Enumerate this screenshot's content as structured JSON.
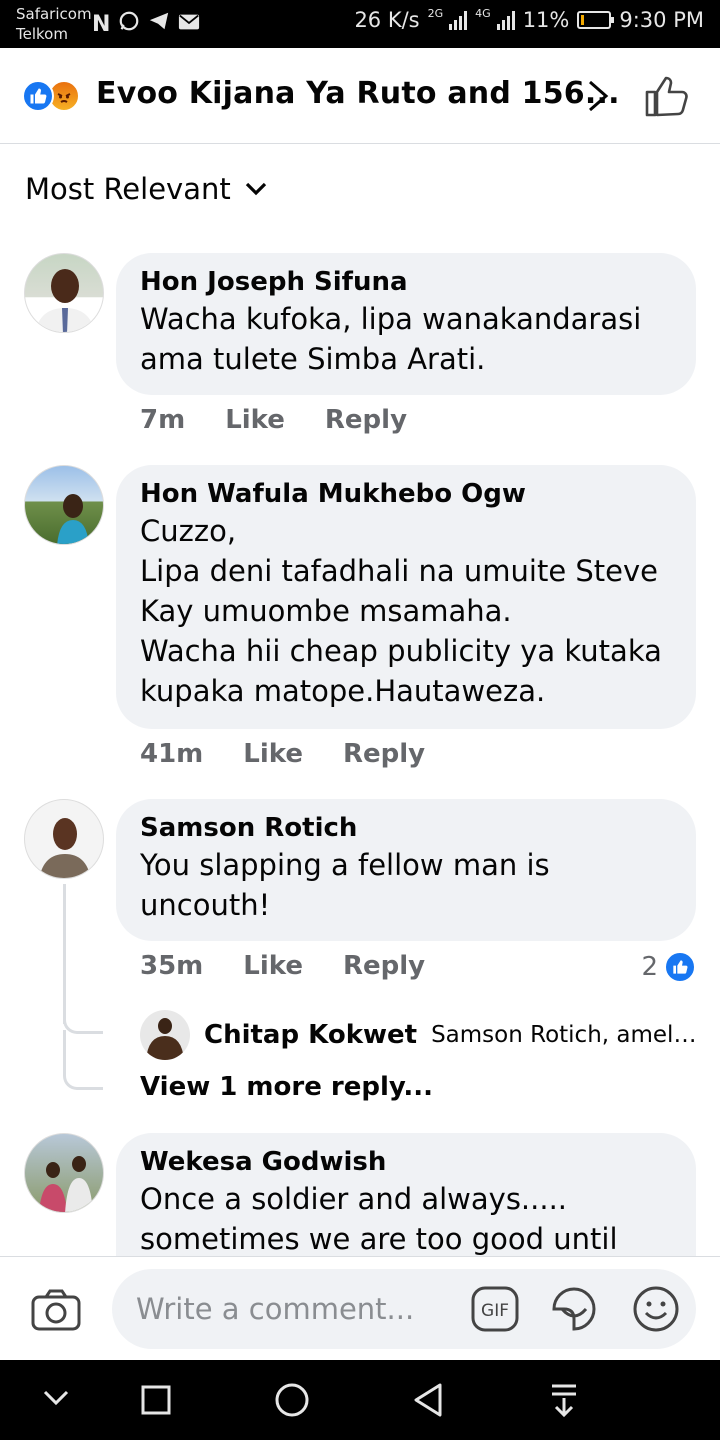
{
  "status_bar": {
    "carrier_1": "Safaricom",
    "carrier_2": "Telkom",
    "speed": "26 K/s",
    "net_1": "2G",
    "net_2": "4G",
    "battery": "11%",
    "battery_level": 0.11,
    "time": "9:30 PM",
    "notification_icons": [
      "n-icon",
      "whatsapp-icon",
      "telegram-icon",
      "mail-icon"
    ]
  },
  "header": {
    "title": "Evoo Kijana Ya Ruto and 156...",
    "reactions": [
      "like-icon",
      "angry-icon"
    ]
  },
  "sort": {
    "label": "Most Relevant"
  },
  "comments": [
    {
      "author": "Hon Joseph Sifuna",
      "text": "Wacha kufoka, lipa wanakandarasi\nama tulete Simba Arati.",
      "time": "7m",
      "like": "Like",
      "reply": "Reply"
    },
    {
      "author": "Hon Wafula Mukhebo Ogw",
      "text": "Cuzzo,\nLipa deni tafadhali na umuite Steve\nKay umuombe msamaha.\nWacha hii cheap publicity ya kutaka\nkupaka matope.Hautaweza.",
      "time": "41m",
      "like": "Like",
      "reply": "Reply"
    },
    {
      "author": "Samson Rotich",
      "text": "You slapping a fellow man is\nuncouth!",
      "time": "35m",
      "like": "Like",
      "reply": "Reply",
      "reaction_count": "2"
    },
    {
      "author": "Wekesa Godwish",
      "text": "Once a soldier and always.....\nsometimes we are too good until"
    }
  ],
  "reply_preview": {
    "author": "Chitap Kokwet",
    "snippet": "Samson Rotich, ameli..."
  },
  "more_replies": "View 1 more reply...",
  "composer": {
    "placeholder": "Write a comment...",
    "gif_label": "GIF"
  },
  "colors": {
    "accent": "#1877f2",
    "bubble": "#f0f2f5",
    "meta_text": "#65676b"
  }
}
